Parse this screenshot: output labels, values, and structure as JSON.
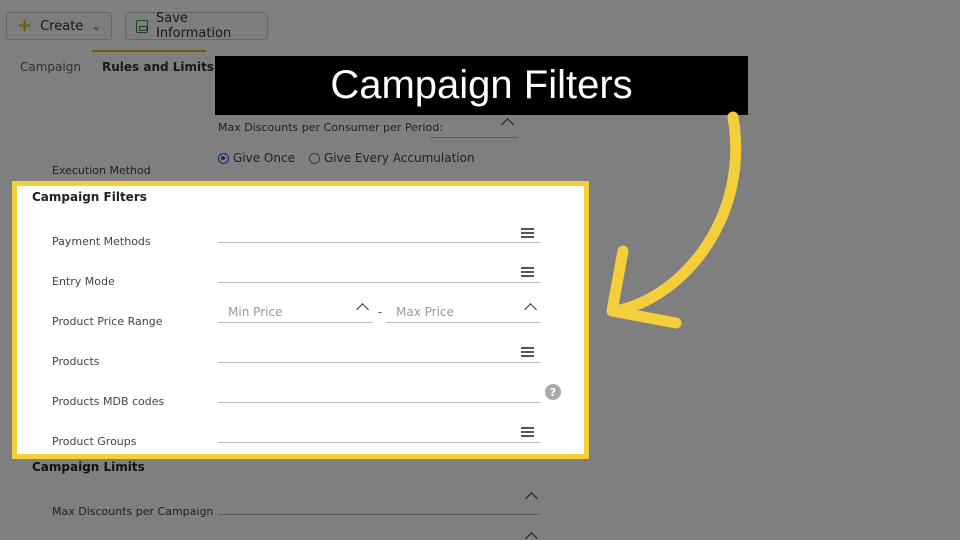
{
  "toolbar": {
    "create_label": "Create",
    "save_label": "Save Information"
  },
  "tabs": [
    {
      "label": "Campaign"
    },
    {
      "label": "Rules and Limits"
    }
  ],
  "background": {
    "max_discounts_consumer_label": "Max Discounts per Consumer per Period:",
    "execution_method_label": "Execution Method",
    "radio_options": [
      {
        "label": "Give Once",
        "selected": true
      },
      {
        "label": "Give Every Accumulation",
        "selected": false
      }
    ],
    "campaign_limits_title": "Campaign Limits",
    "max_discounts_campaign_label": "Max Discounts per Campaign"
  },
  "callout": {
    "text": "Campaign Filters"
  },
  "filters": {
    "title": "Campaign Filters",
    "rows": {
      "payment_methods": "Payment Methods",
      "entry_mode": "Entry Mode",
      "product_price_range": "Product Price Range",
      "products": "Products",
      "products_mdb_codes": "Products MDB codes",
      "product_groups": "Product Groups"
    },
    "min_price_placeholder": "Min Price",
    "max_price_placeholder": "Max Price",
    "range_separator": "-",
    "help_symbol": "?"
  },
  "colors": {
    "highlight_border": "#f5cf3b",
    "arrow": "#f5cf3b",
    "accent": "#e8b400",
    "radio": "#1f5fbf"
  },
  "icons": [
    "plus-icon",
    "chevron-down-icon",
    "save-icon",
    "list-icon",
    "chevron-up-icon",
    "help-icon",
    "curved-arrow-icon"
  ]
}
